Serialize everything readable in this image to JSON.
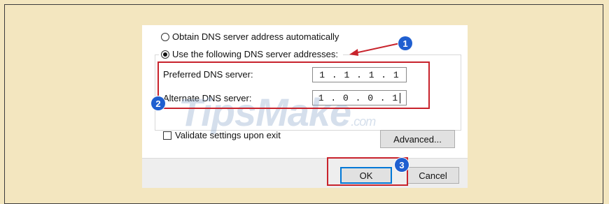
{
  "dns_options": {
    "auto_label": "Obtain DNS server address automatically",
    "manual_label": "Use the following DNS server addresses:"
  },
  "dns_fields": {
    "preferred_label": "Preferred DNS server:",
    "preferred_value": "1 . 1 . 1 . 1",
    "alternate_label": "Alternate DNS server:",
    "alternate_value": "1 . 0 . 0 . 1"
  },
  "validate_label": "Validate settings upon exit",
  "buttons": {
    "advanced": "Advanced...",
    "ok": "OK",
    "cancel": "Cancel"
  },
  "annotations": {
    "step1": "1",
    "step2": "2",
    "step3": "3",
    "accent_color": "#c8232c",
    "badge_color": "#1f5fd0"
  },
  "watermark": {
    "text": "TipsMake",
    "suffix": ".com"
  }
}
